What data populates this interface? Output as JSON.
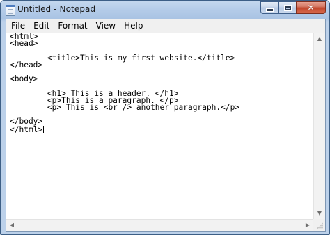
{
  "window": {
    "title": "Untitled - Notepad"
  },
  "caption_buttons": {
    "close_glyph": "✕"
  },
  "menu": {
    "items": [
      "File",
      "Edit",
      "Format",
      "View",
      "Help"
    ]
  },
  "editor": {
    "content": "<html>\n<head>\n\n\t<title>This is my first website.</title>\n</head>\n\n<body>\n\n\t<h1> This is a header. </h1>\n\t<p>This is a paragraph. </p>\n\t<p> This is <br /> another paragraph.</p>\n\n</body>\n</html>"
  },
  "scrollbars": {
    "up_arrow": "▲",
    "down_arrow": "▼",
    "left_arrow": "◀",
    "right_arrow": "▶"
  }
}
